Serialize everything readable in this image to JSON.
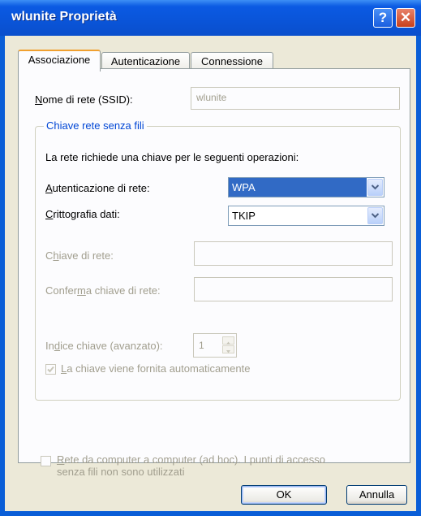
{
  "window": {
    "title": "wlunite Proprietà"
  },
  "titlebar_buttons": {
    "help": "?",
    "close": "✕"
  },
  "tabs": [
    {
      "label": "Associazione",
      "active": true
    },
    {
      "label": "Autenticazione",
      "active": false
    },
    {
      "label": "Connessione",
      "active": false
    }
  ],
  "ssid": {
    "label_pre": "N",
    "label_rest": "ome di rete (SSID):",
    "value": "wlunite"
  },
  "group": {
    "legend": "Chiave rete senza fili",
    "description": "La rete richiede una chiave per le seguenti operazioni:",
    "auth": {
      "label_pre": "A",
      "label_rest": "utenticazione di rete:",
      "value": "WPA"
    },
    "crypto": {
      "label_pre": "C",
      "label_rest": "rittografia dati:",
      "value": "TKIP"
    },
    "network_key": {
      "label_pre": "C",
      "label_u": "h",
      "label_rest": "iave di rete:"
    },
    "confirm_key": {
      "label_pre": "Confer",
      "label_u": "m",
      "label_rest": "a chiave di rete:"
    },
    "key_index": {
      "label_pre": "In",
      "label_u": "d",
      "label_rest": "ice chiave (avanzato):",
      "value": "1"
    },
    "auto_key": {
      "label_u": "L",
      "label_rest": "a chiave viene fornita automaticamente",
      "checked": true
    }
  },
  "adhoc": {
    "label_u": "R",
    "label_rest_line1": "ete da computer a computer (ad hoc). I punti di accesso",
    "label_line2": "senza fili non sono utilizzati",
    "checked": false
  },
  "buttons": {
    "ok": "OK",
    "cancel": "Annulla"
  },
  "colors": {
    "titlebar": "#0a54d8",
    "dialog_bg": "#ece9d8",
    "selection": "#316ac5",
    "legend": "#0046d5",
    "disabled_text": "#a19e8e"
  }
}
